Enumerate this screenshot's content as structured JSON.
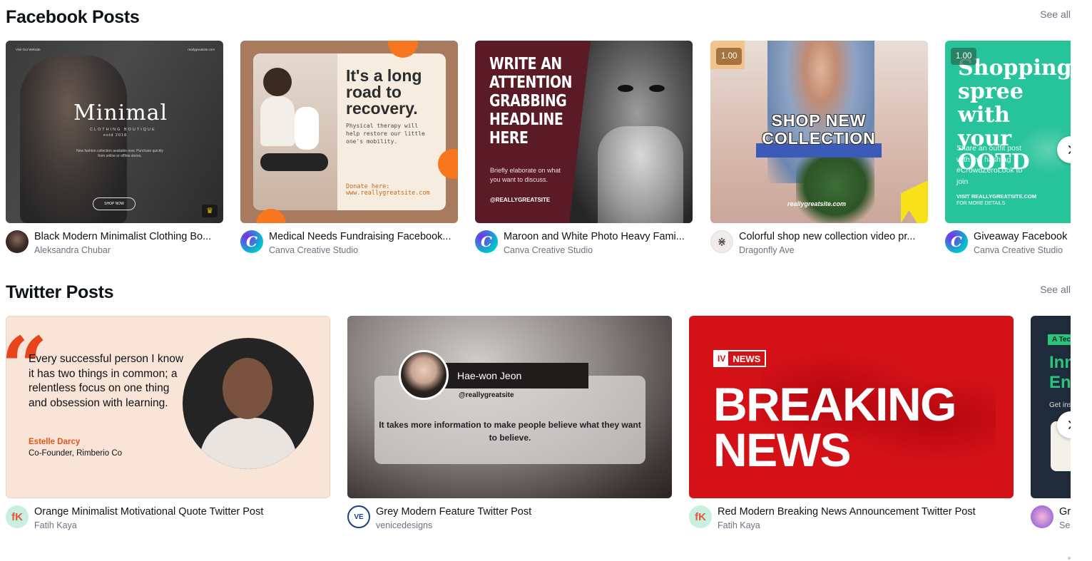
{
  "facebook": {
    "title": "Facebook Posts",
    "see_all": "See all",
    "cards": [
      {
        "title": "Black Modern Minimalist Clothing Bo...",
        "author": "Aleksandra Chubar",
        "thumb": {
          "corner_left": "Visit Our Website",
          "corner_right": "reallygreatsite.com",
          "headline": "Minimal",
          "sub": "CLOTHING BOUTIQUE",
          "est": "estd 2018",
          "body": "New fashion collection available now. Purchase quickly from online or offline stores.",
          "button": "SHOP NOW",
          "crown": "♛"
        }
      },
      {
        "title": "Medical Needs Fundraising Facebook...",
        "author": "Canva Creative Studio",
        "avatar_letter": "C",
        "thumb": {
          "headline": "It's a long road to recovery.",
          "body": "Physical therapy will help restore our little one's mobility.",
          "donate": "Donate here:",
          "url": "www.reallygreatsite.com"
        }
      },
      {
        "title": "Maroon and White Photo Heavy Fami...",
        "author": "Canva Creative Studio",
        "avatar_letter": "C",
        "thumb": {
          "headline": "WRITE AN ATTENTION GRABBING HEADLINE HERE",
          "body": "Briefly elaborate on what you want to discuss.",
          "handle": "@REALLYGREATSITE"
        }
      },
      {
        "title": "Colorful shop new collection video pr...",
        "author": "Dragonfly Ave",
        "badge": "1.00",
        "thumb": {
          "headline": "SHOP NEW COLLECTION",
          "url": "reallygreatsite.com"
        }
      },
      {
        "title": "Giveaway Facebook",
        "author": "Canva Creative Studio",
        "avatar_letter": "C",
        "badge": "1.00",
        "thumb": {
          "headline": "Shopping spree with your OOTD",
          "body": "Share an outfit post with the hashtag #CrowdZeroLook to join",
          "visit": "VISIT REALLYGREATSITE.COM",
          "visit2": "FOR MORE DETAILS"
        }
      }
    ]
  },
  "twitter": {
    "title": "Twitter Posts",
    "see_all": "See all",
    "cards": [
      {
        "title": "Orange Minimalist Motivational Quote Twitter Post",
        "author": "Fatih Kaya",
        "avatar_letter": "fK",
        "thumb": {
          "quote_mark": "“",
          "quote": "Every successful person I know it has two things in common; a relentless focus on one thing and obsession with learning.",
          "name": "Estelle Darcy",
          "role": "Co-Founder, Rimberio Co"
        }
      },
      {
        "title": "Grey Modern Feature Twitter Post",
        "author": "venicedesigns",
        "avatar_letter": "VE",
        "thumb": {
          "name": "Hae-won Jeon",
          "handle": "@reallygreatsite",
          "body": "It takes more information to make people believe what they want to believe."
        }
      },
      {
        "title": "Red Modern Breaking News Announcement Twitter Post",
        "author": "Fatih Kaya",
        "avatar_letter": "fK",
        "thumb": {
          "logo_iv": "IV",
          "logo_news": "NEWS",
          "headline": "BREAKING NEWS"
        }
      },
      {
        "title": "Gr",
        "author": "Se",
        "thumb": {
          "tag": "A Tec",
          "big": "Inn En",
          "small": "Get ins"
        }
      }
    ]
  },
  "icons": {
    "next": "chevron-right-icon",
    "crown": "crown-icon"
  }
}
